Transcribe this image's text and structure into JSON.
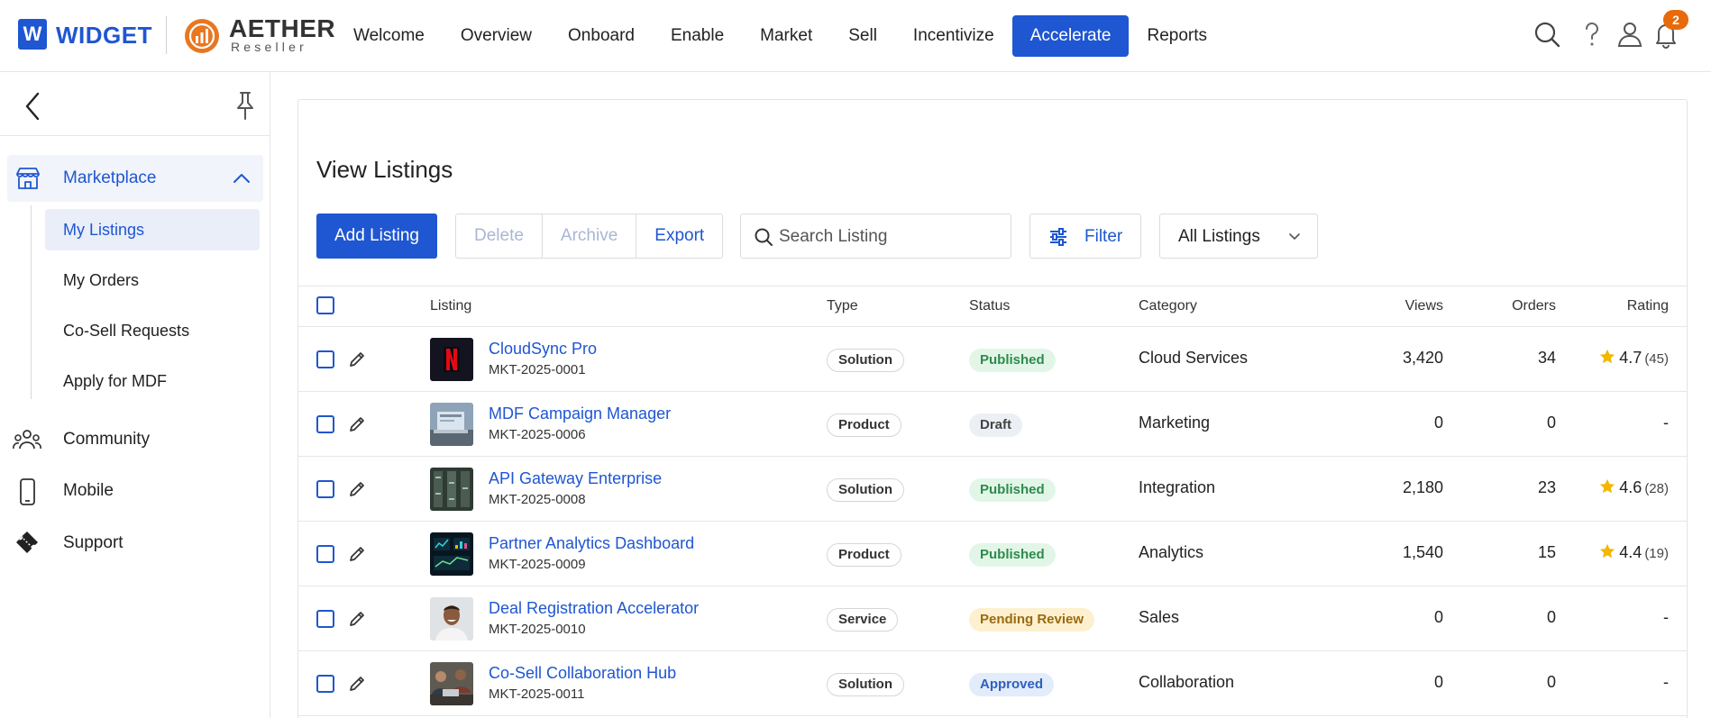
{
  "brand": {
    "widget_letter": "W",
    "widget_name": "WIDGET",
    "aether_name": "AETHER",
    "aether_sub": "Reseller"
  },
  "nav": [
    {
      "label": "Welcome"
    },
    {
      "label": "Overview"
    },
    {
      "label": "Onboard"
    },
    {
      "label": "Enable"
    },
    {
      "label": "Market"
    },
    {
      "label": "Sell"
    },
    {
      "label": "Incentivize"
    },
    {
      "label": "Accelerate",
      "active": true
    },
    {
      "label": "Reports"
    }
  ],
  "header": {
    "notification_count": "2"
  },
  "sidebar": {
    "group": {
      "label": "Marketplace",
      "icon": "store-icon"
    },
    "sub_items": [
      {
        "label": "My Listings",
        "active": true
      },
      {
        "label": "My Orders"
      },
      {
        "label": "Co-Sell Requests"
      },
      {
        "label": "Apply for MDF"
      }
    ],
    "items": [
      {
        "label": "Community",
        "icon": "community-icon"
      },
      {
        "label": "Mobile",
        "icon": "mobile-icon"
      },
      {
        "label": "Support",
        "icon": "ticket-icon"
      }
    ]
  },
  "main": {
    "title": "View Listings",
    "add_label": "Add Listing",
    "actions": {
      "delete": "Delete",
      "archive": "Archive",
      "export": "Export"
    },
    "search_placeholder": "Search Listing",
    "filter_label": "Filter",
    "select_value": "All Listings"
  },
  "table": {
    "columns": {
      "listing": "Listing",
      "type": "Type",
      "status": "Status",
      "category": "Category",
      "views": "Views",
      "orders": "Orders",
      "rating": "Rating"
    },
    "rows": [
      {
        "name": "CloudSync Pro",
        "id": "MKT-2025-0001",
        "type": "Solution",
        "status": "Published",
        "status_kind": "published",
        "category": "Cloud Services",
        "views": "3,420",
        "orders": "34",
        "rating": "4.7",
        "rating_count": "(45)",
        "thumb": "netflix"
      },
      {
        "name": "MDF Campaign Manager",
        "id": "MKT-2025-0006",
        "type": "Product",
        "status": "Draft",
        "status_kind": "draft",
        "category": "Marketing",
        "views": "0",
        "orders": "0",
        "rating": "-",
        "rating_count": "",
        "thumb": "laptop"
      },
      {
        "name": "API Gateway Enterprise",
        "id": "MKT-2025-0008",
        "type": "Solution",
        "status": "Published",
        "status_kind": "published",
        "category": "Integration",
        "views": "2,180",
        "orders": "23",
        "rating": "4.6",
        "rating_count": "(28)",
        "thumb": "servers"
      },
      {
        "name": "Partner Analytics Dashboard",
        "id": "MKT-2025-0009",
        "type": "Product",
        "status": "Published",
        "status_kind": "published",
        "category": "Analytics",
        "views": "1,540",
        "orders": "15",
        "rating": "4.4",
        "rating_count": "(19)",
        "thumb": "dashboard"
      },
      {
        "name": "Deal Registration Accelerator",
        "id": "MKT-2025-0010",
        "type": "Service",
        "status": "Pending Review",
        "status_kind": "pending",
        "category": "Sales",
        "views": "0",
        "orders": "0",
        "rating": "-",
        "rating_count": "",
        "thumb": "person"
      },
      {
        "name": "Co-Sell Collaboration Hub",
        "id": "MKT-2025-0011",
        "type": "Solution",
        "status": "Approved",
        "status_kind": "approved",
        "category": "Collaboration",
        "views": "0",
        "orders": "0",
        "rating": "-",
        "rating_count": "",
        "thumb": "team"
      }
    ]
  },
  "colors": {
    "accent": "#1f56d1",
    "badge": "#e86a0a",
    "star": "#f2b705"
  }
}
